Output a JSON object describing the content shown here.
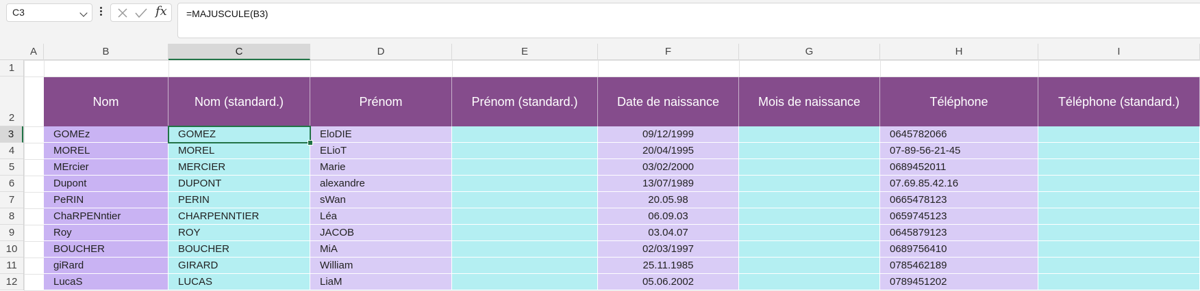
{
  "formula_bar": {
    "name_box": "C3",
    "formula": "=MAJUSCULE(B3)",
    "fx_label": "fx"
  },
  "columns": [
    "A",
    "B",
    "C",
    "D",
    "E",
    "F",
    "G",
    "H",
    "I"
  ],
  "rows": [
    "1",
    "2",
    "3",
    "4",
    "5",
    "6",
    "7",
    "8",
    "9",
    "10",
    "11",
    "12"
  ],
  "table": {
    "headers": [
      "Nom",
      "Nom (standard.)",
      "Prénom",
      "Prénom (standard.)",
      "Date de naissance",
      "Mois de naissance",
      "Téléphone",
      "Téléphone (standard.)"
    ],
    "rows": [
      [
        "GOMEz",
        "GOMEZ",
        "EloDIE",
        "",
        "09/12/1999",
        "",
        "0645782066",
        ""
      ],
      [
        "MOREL",
        "MOREL",
        "ELioT",
        "",
        "20/04/1995",
        "",
        "07-89-56-21-45",
        ""
      ],
      [
        "MErcier",
        "MERCIER",
        "Marie",
        "",
        "03/02/2000",
        "",
        "0689452011",
        ""
      ],
      [
        "Dupont",
        "DUPONT",
        "alexandre",
        "",
        "13/07/1989",
        "",
        "07.69.85.42.16",
        ""
      ],
      [
        "PeRIN",
        "PERIN",
        "sWan",
        "",
        "20.05.98",
        "",
        "0665478123",
        ""
      ],
      [
        "ChaRPENntier",
        "CHARPENNTIER",
        "Léa",
        "",
        "06.09.03",
        "",
        "0659745123",
        ""
      ],
      [
        "Roy",
        "ROY",
        "JACOB",
        "",
        "03.04.07",
        "",
        "0645879123",
        ""
      ],
      [
        "BOUCHER",
        "BOUCHER",
        "MiA",
        "",
        "02/03/1997",
        "",
        "0689756410",
        ""
      ],
      [
        "giRard",
        "GIRARD",
        "William",
        "",
        "25.11.1985",
        "",
        "0785462189",
        ""
      ],
      [
        "LucaS",
        "LUCAS",
        "LiaM",
        "",
        "05.06.2002",
        "",
        "0789451202",
        ""
      ]
    ]
  },
  "colors": {
    "header_bg": "#854c8c",
    "purple_cell": "#d9ccf6",
    "cyan_cell": "#b4eff2",
    "selection": "#217346"
  }
}
